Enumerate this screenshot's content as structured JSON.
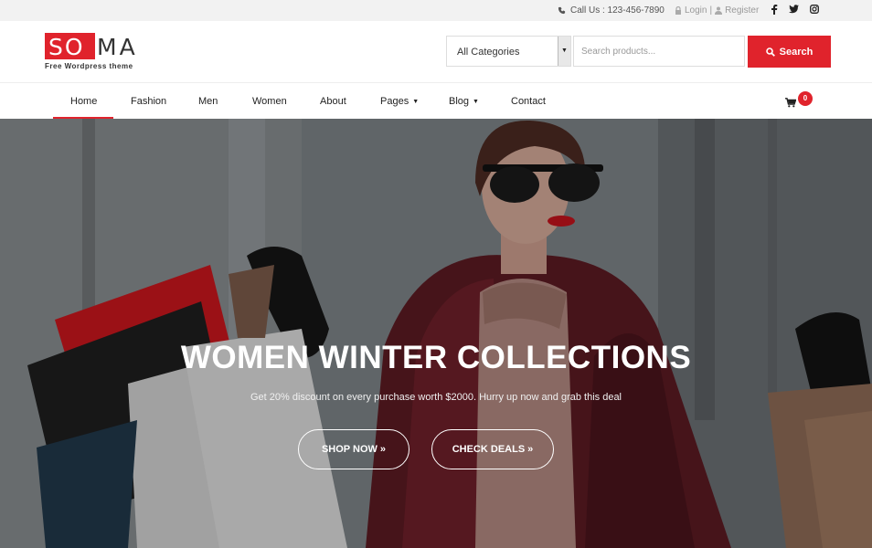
{
  "topbar": {
    "contact": "Call Us : 123-456-7890",
    "login": "Login",
    "separator": "|",
    "register": "Register",
    "social": [
      "f",
      "t",
      "ig"
    ]
  },
  "logo": {
    "part1": "SO",
    "part2": "MA",
    "tagline": "Free Wordpress theme"
  },
  "search": {
    "category": "All Categories",
    "placeholder": "Search products...",
    "button": "Search"
  },
  "nav": {
    "items": [
      {
        "label": "Home",
        "active": true
      },
      {
        "label": "Fashion"
      },
      {
        "label": "Men"
      },
      {
        "label": "Women"
      },
      {
        "label": "About"
      },
      {
        "label": "Pages",
        "dropdown": true
      },
      {
        "label": "Blog",
        "dropdown": true
      },
      {
        "label": "Contact"
      }
    ],
    "cart_count": "0"
  },
  "hero": {
    "title": "WOMEN WINTER COLLECTIONS",
    "subtitle": "Get 20% discount on every purchase worth $2000. Hurry up now and grab this deal",
    "shop_button": "SHOP NOW",
    "deals_button": "CHECK DEALS",
    "chevron": "»"
  },
  "colors": {
    "accent": "#e0232c",
    "topbar_bg": "#f2f2f2"
  }
}
